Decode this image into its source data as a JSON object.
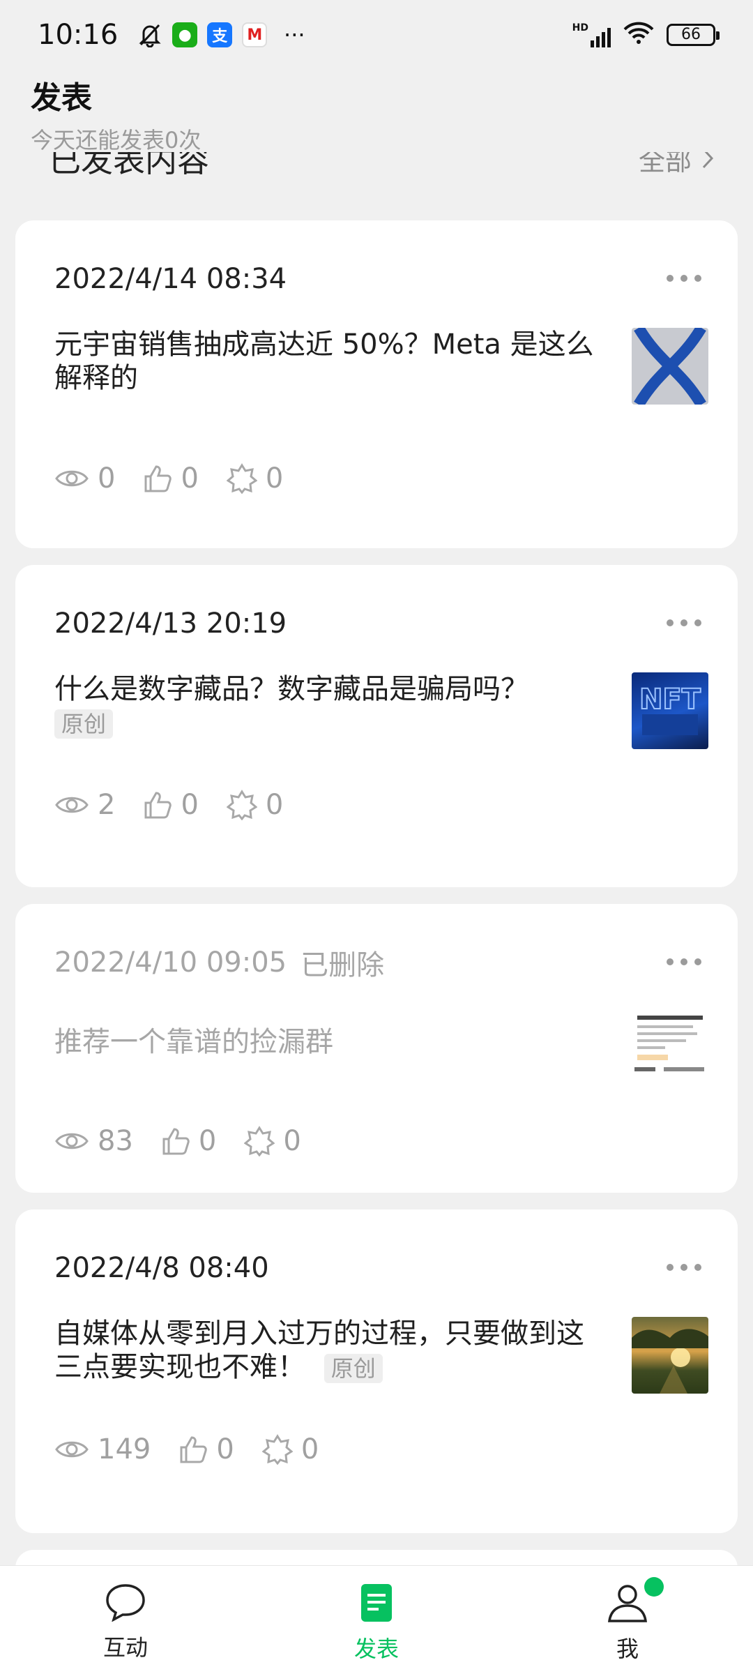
{
  "status_bar": {
    "time": "10:16",
    "network_label": "HD",
    "battery": "66",
    "more": "···"
  },
  "header": {
    "title": "发表",
    "subtitle": "今天还能发表0次"
  },
  "section": {
    "label": "已发表内容",
    "more": "全部"
  },
  "posts": [
    {
      "date": "2022/4/14 08:34",
      "status": "",
      "title": "元宇宙销售抽成高达近 50%？Meta 是这么解释的",
      "tag": "",
      "views": "0",
      "likes": "0",
      "shares": "0",
      "thumb": "meta-logo"
    },
    {
      "date": "2022/4/13 20:19",
      "status": "",
      "title": "什么是数字藏品？数字藏品是骗局吗？",
      "tag": "原创",
      "views": "2",
      "likes": "0",
      "shares": "0",
      "thumb": "nft-image"
    },
    {
      "date": "2022/4/10 09:05",
      "status": "已删除",
      "title": "推荐一个靠谱的捡漏群",
      "tag": "",
      "views": "83",
      "likes": "0",
      "shares": "0",
      "thumb": "product-listing"
    },
    {
      "date": "2022/4/8 08:40",
      "status": "",
      "title": "自媒体从零到月入过万的过程，只要做到这三点要实现也不难！",
      "tag": "原创",
      "views": "149",
      "likes": "0",
      "shares": "0",
      "thumb": "sunset-photo"
    }
  ],
  "nav": {
    "interact": "互动",
    "publish": "发表",
    "me": "我"
  },
  "colors": {
    "accent": "#07c160",
    "muted": "#a0a0a0",
    "background": "#f0f0f0"
  }
}
